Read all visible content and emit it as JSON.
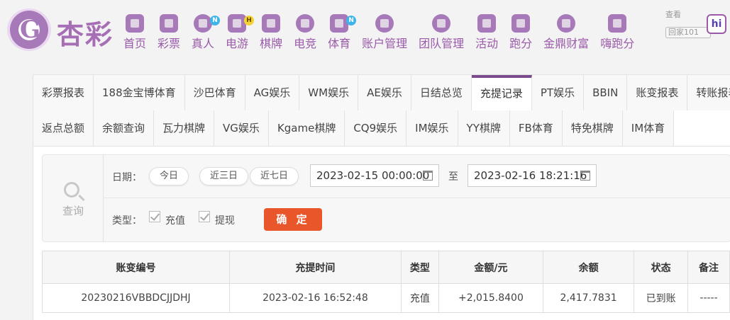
{
  "brand": {
    "logo_text": "杏彩"
  },
  "nav": [
    {
      "label": "首页",
      "icon": "home-icon"
    },
    {
      "label": "彩票",
      "icon": "lottery-ticket-icon"
    },
    {
      "label": "真人",
      "icon": "live-dealer-icon",
      "badge": "N"
    },
    {
      "label": "电游",
      "icon": "slot-game-icon",
      "badge": "H"
    },
    {
      "label": "棋牌",
      "icon": "cards-icon"
    },
    {
      "label": "电竞",
      "icon": "gamepad-icon"
    },
    {
      "label": "体育",
      "icon": "trophy-icon",
      "badge": "N"
    },
    {
      "label": "账户管理",
      "icon": "yen-coin-icon"
    },
    {
      "label": "团队管理",
      "icon": "team-icon"
    },
    {
      "label": "活动",
      "icon": "gift-icon"
    },
    {
      "label": "跑分",
      "icon": "running-icon"
    },
    {
      "label": "金鼎财富",
      "icon": "wealth-icon"
    },
    {
      "label": "嗨跑分",
      "icon": "hi-run-icon"
    }
  ],
  "watermark": {
    "line1": "查看",
    "line2": "回家101"
  },
  "tabs_row1": [
    "彩票报表",
    "188金宝博体育",
    "沙巴体育",
    "AG娱乐",
    "WM娱乐",
    "AE娱乐",
    "日结总览",
    "充提记录",
    "PT娱乐",
    "BBIN",
    "账变报表",
    "转账报表"
  ],
  "tabs_row2": [
    "返点总额",
    "余额查询",
    "瓦力棋牌",
    "VG娱乐",
    "Kgame棋牌",
    "CQ9娱乐",
    "IM娱乐",
    "YY棋牌",
    "FB体育",
    "特免棋牌",
    "IM体育"
  ],
  "active_tab": "充提记录",
  "filter": {
    "query_label": "查询",
    "date_label": "日期：",
    "quick_today": "今日",
    "quick_3days": "近三日",
    "quick_7days": "近七日",
    "start_date": "2023-02-15 00:00:00",
    "to_label": "至",
    "end_date": "2023-02-16 18:21:16",
    "type_label": "类型：",
    "type_deposit": "充值",
    "type_withdraw": "提现",
    "confirm_label": "确 定"
  },
  "table": {
    "headers": [
      "账变编号",
      "充提时间",
      "类型",
      "金额/元",
      "余额",
      "状态",
      "备注"
    ],
    "rows": [
      {
        "id": "20230216VBBDCJJDHJ",
        "time": "2023-02-16 16:52:48",
        "type": "充值",
        "amount": "+2,015.8400",
        "balance": "2,417.7831",
        "status": "已到账",
        "remark": "-----"
      }
    ]
  },
  "colors": {
    "brand_purple": "#9a5aa9",
    "confirm_orange": "#e8562a",
    "amount_red": "#d81e06",
    "status_green": "#3aa23a"
  }
}
